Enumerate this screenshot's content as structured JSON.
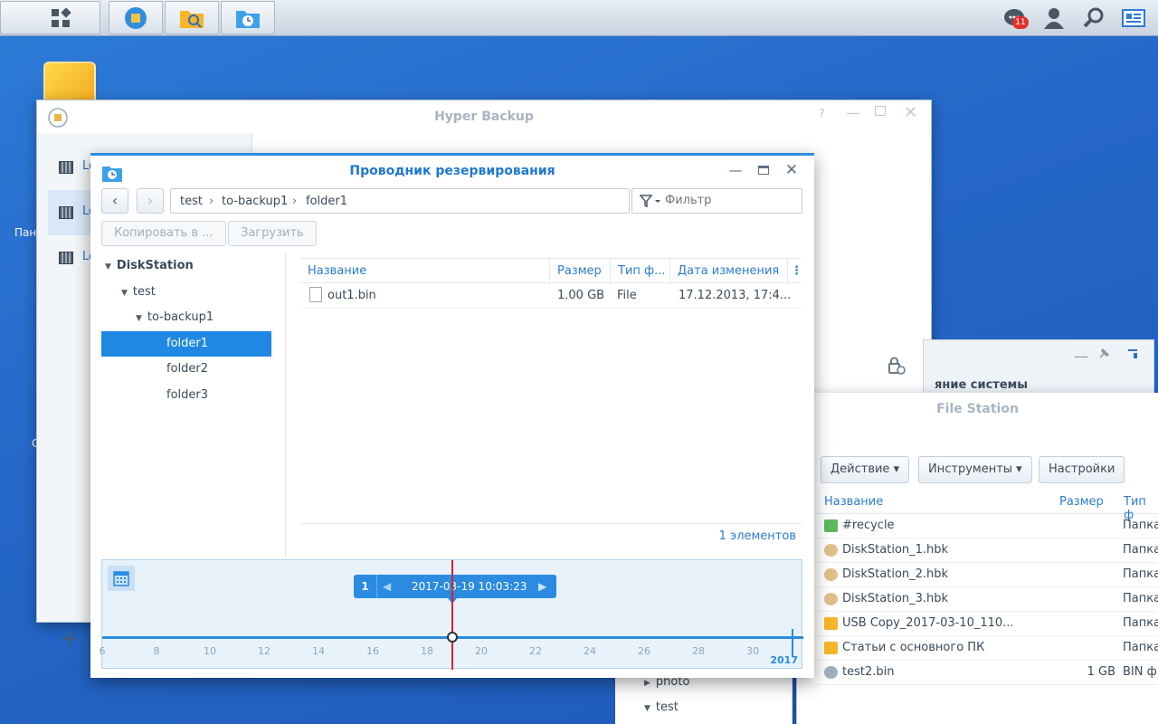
{
  "taskbar": {
    "notification_count": "11"
  },
  "desktop": {
    "label_1": "Пан",
    "label_2": "С"
  },
  "hyper_backup": {
    "title": "Hyper Backup",
    "tasks": [
      {
        "label": "Lo"
      },
      {
        "label": "Lo"
      },
      {
        "label": "Lo"
      }
    ]
  },
  "widget": {
    "text": "яние системы"
  },
  "file_station": {
    "title": "File Station",
    "buttons": {
      "action": "Действие",
      "tools": "Инструменты",
      "settings": "Настройки"
    },
    "columns": {
      "name": "Название",
      "size": "Размер",
      "type": "Тип ф"
    },
    "rows": [
      {
        "name": "#recycle",
        "size": "",
        "type": "Папка",
        "icon": "recycle"
      },
      {
        "name": "DiskStation_1.hbk",
        "size": "",
        "type": "Папка",
        "icon": "backup"
      },
      {
        "name": "DiskStation_2.hbk",
        "size": "",
        "type": "Папка",
        "icon": "backup"
      },
      {
        "name": "DiskStation_3.hbk",
        "size": "",
        "type": "Папка",
        "icon": "backup"
      },
      {
        "name": "USB Copy_2017-03-10_110...",
        "size": "",
        "type": "Папка",
        "icon": "folder"
      },
      {
        "name": "Статьи с основного ПК",
        "size": "",
        "type": "Папка",
        "icon": "folder"
      },
      {
        "name": "test2.bin",
        "size": "1 GB",
        "type": "BIN ф",
        "icon": "file"
      }
    ],
    "tree": [
      "photo",
      "test"
    ]
  },
  "explorer": {
    "title": "Проводник резервирования",
    "path": [
      "test",
      "to-backup1",
      "folder1"
    ],
    "filter_placeholder": "Фильтр",
    "copy_button": "Копировать в ...",
    "download_button": "Загрузить",
    "tree": {
      "root": "DiskStation",
      "test": "test",
      "backup": "to-backup1",
      "folders": [
        "folder1",
        "folder2",
        "folder3"
      ]
    },
    "columns": {
      "name": "Название",
      "size": "Размер",
      "type": "Тип ф...",
      "date": "Дата изменения"
    },
    "files": [
      {
        "name": "out1.bin",
        "size": "1.00 GB",
        "type": "File",
        "date": "17.12.2013, 17:4..."
      }
    ],
    "count": "1 элементов",
    "timeline": {
      "version": "1",
      "datetime": "2017-03-19 10:03:23",
      "year": "2017",
      "ticks": [
        "6",
        "8",
        "10",
        "12",
        "14",
        "16",
        "18",
        "20",
        "22",
        "24",
        "26",
        "28",
        "30"
      ]
    }
  },
  "colors": {
    "accent": "#1f88e3",
    "marker": "#d1252b",
    "desktop": "#2567c8"
  }
}
